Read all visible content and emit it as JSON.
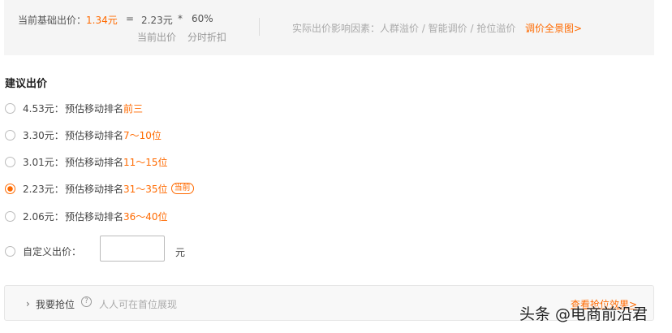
{
  "formula": {
    "base_label": "当前基础出价：",
    "base_value": "1.34元",
    "equals": "=",
    "current_bid": "2.23元",
    "multiply": "*",
    "discount": "60%",
    "current_bid_label": "当前出价",
    "discount_label": "分时折扣"
  },
  "factors": {
    "text": "实际出价影响因素：人群溢价 / 智能调价 / 抢位溢价",
    "link": "调价全景图>"
  },
  "section_title": "建议出价",
  "options": [
    {
      "price": "4.53元：",
      "rank_prefix": "预估移动排名",
      "rank": "前三",
      "badge": "",
      "checked": false
    },
    {
      "price": "3.30元：",
      "rank_prefix": "预估移动排名",
      "rank": "7～10位",
      "badge": "",
      "checked": false
    },
    {
      "price": "3.01元：",
      "rank_prefix": "预估移动排名",
      "rank": "11～15位",
      "badge": "",
      "checked": false
    },
    {
      "price": "2.23元：",
      "rank_prefix": "预估移动排名",
      "rank": "31～35位",
      "badge": "当前",
      "checked": true
    },
    {
      "price": "2.06元：",
      "rank_prefix": "预估移动排名",
      "rank": "36～40位",
      "badge": "",
      "checked": false
    }
  ],
  "custom": {
    "label": "自定义出价：",
    "value": "",
    "unit": "元"
  },
  "grab": {
    "label": "我要抢位",
    "help_icon": "question-icon",
    "help_glyph": "?",
    "hint": "人人可在首位展现",
    "link": "查看抢位效果>",
    "chevron_glyph": "›"
  },
  "watermark": "头条 @电商前沿君",
  "colors": {
    "accent": "#ff6a00"
  }
}
